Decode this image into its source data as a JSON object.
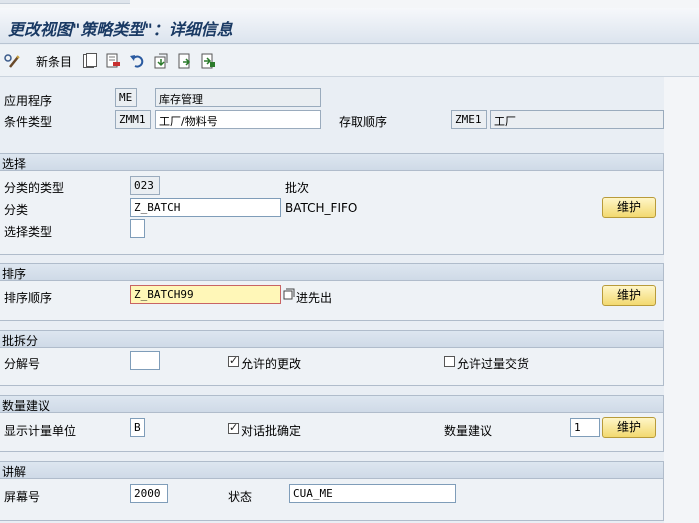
{
  "title": "更改视图\"策略类型\"：详细信息",
  "toolbar": {
    "new_entries_label": "新条目",
    "icons": [
      "change-display-icon",
      "copy-icon",
      "delete-icon",
      "undo-icon",
      "select-all-icon",
      "previous-entry-icon",
      "next-entry-icon"
    ]
  },
  "header": {
    "application_label": "应用程序",
    "application_code": "ME",
    "application_name": "库存管理",
    "condition_type_label": "条件类型",
    "condition_type_code": "ZMM1",
    "condition_type_name": "工厂/物料号",
    "access_sequence_label": "存取顺序",
    "access_sequence_code": "ZME1",
    "access_sequence_name": "工厂"
  },
  "selection": {
    "heading": "选择",
    "class_type_label": "分类的类型",
    "class_type_value": "023",
    "class_type_desc": "批次",
    "class_label": "分类",
    "class_value": "Z_BATCH",
    "class_desc": "BATCH_FIFO",
    "maintain_label": "维护",
    "selection_type_label": "选择类型",
    "selection_type_value": ""
  },
  "sort": {
    "heading": "排序",
    "sort_rule_label": "排序顺序",
    "sort_rule_value": "Z_BATCH99",
    "sort_rule_desc": "进先出",
    "maintain_label": "维护"
  },
  "batch_split": {
    "heading": "批拆分",
    "split_count_label": "分解号",
    "split_count_value": "",
    "allow_change_label": "允许的更改",
    "allow_change_checked": true,
    "allow_over_delivery_label": "允许过量交货",
    "allow_over_delivery_checked": false
  },
  "quantity_proposal": {
    "heading": "数量建议",
    "display_uom_label": "显示计量单位",
    "display_uom_value": "B",
    "dialog_batch_label": "对话批确定",
    "dialog_batch_checked": true,
    "qty_proposal_label": "数量建议",
    "qty_proposal_value": "1",
    "maintain_label": "维护"
  },
  "explanation": {
    "heading": "讲解",
    "screen_no_label": "屏幕号",
    "screen_no_value": "2000",
    "status_label": "状态",
    "status_value": "CUA_ME"
  }
}
